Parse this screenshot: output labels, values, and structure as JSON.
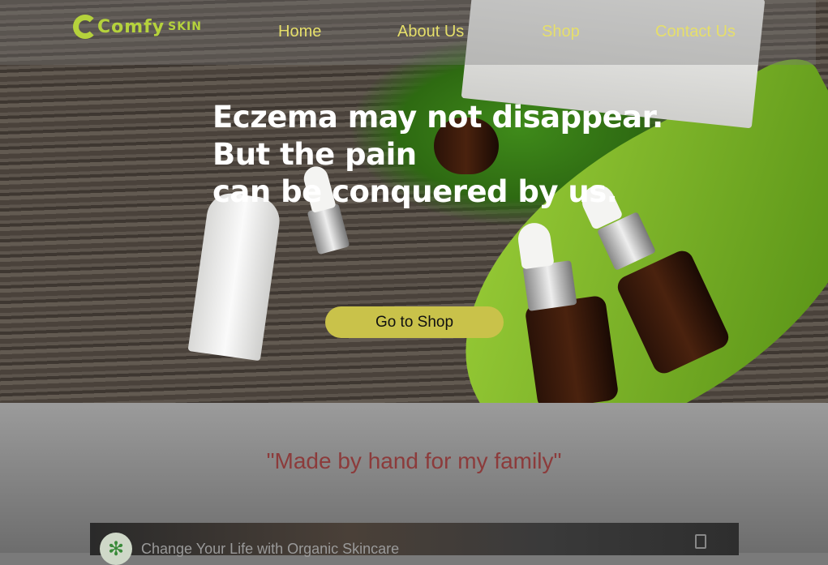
{
  "logo": {
    "text_main": "Comfy",
    "text_sub": "SKIN"
  },
  "nav": {
    "items": [
      "Home",
      "About Us",
      "Shop",
      "Contact Us"
    ]
  },
  "hero": {
    "headline": [
      "Eczema may not disappear.",
      "But the pain",
      "can be conquered by us."
    ],
    "button": "Go to Shop"
  },
  "quote": "\"Made by hand for my family\"",
  "video": {
    "title": "Change Your Life with Organic Skincare"
  },
  "colors": {
    "nav_text": "#e6df6a",
    "button": "#c9c24a",
    "quote": "#8c3b3b",
    "logo": "#b5d23c"
  }
}
